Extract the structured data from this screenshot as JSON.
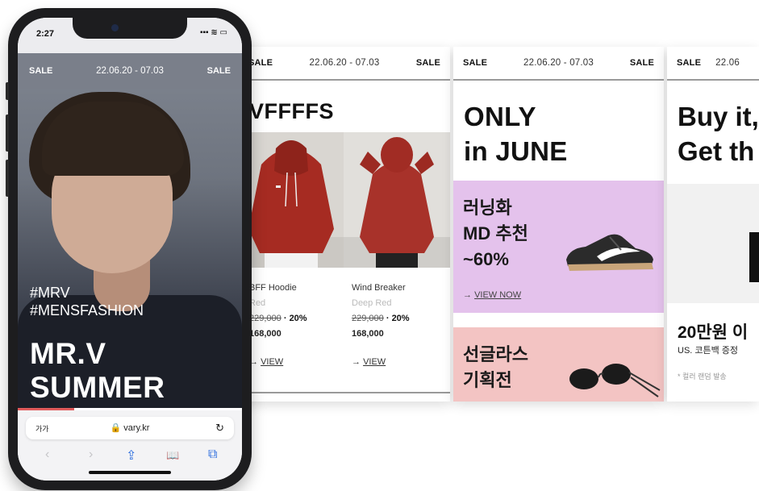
{
  "phone": {
    "status": {
      "time": "2:27",
      "signal_icons": "▪▪▪ ≋ ▭"
    },
    "header": {
      "left": "SALE",
      "date": "22.06.20 - 07.03",
      "right": "SALE"
    },
    "hashtags": [
      "#MRV",
      "#MENSFASHION"
    ],
    "title_lines": [
      "MR.V",
      "SUMMER"
    ],
    "progress": 0.25,
    "browser": {
      "aa_label": "가가",
      "url": "🔒 vary.kr",
      "reload_icon": "↻",
      "back_icon": "‹",
      "forward_icon": "›",
      "share_icon": "⇪",
      "bookmarks_icon": "📖",
      "tabs_icon": "⧉"
    }
  },
  "panel2": {
    "header": {
      "left": "SALE",
      "date": "22.06.20 - 07.03",
      "right": "SALE"
    },
    "title": "VFFFFS",
    "products": [
      {
        "name": "BFF Hoodie",
        "color": "Red",
        "old_price": "229,000",
        "discount": "20%",
        "price": "168,000",
        "link": "VIEW"
      },
      {
        "name": "Wind Breaker",
        "color": "Deep Red",
        "old_price": "229,000",
        "discount": "20%",
        "price": "168,000",
        "link": "VIEW"
      }
    ],
    "arrow": "→",
    "dot": "·"
  },
  "panel3": {
    "header": {
      "left": "SALE",
      "date": "22.06.20 - 07.03",
      "right": "SALE"
    },
    "title_lines": [
      "ONLY",
      "in JUNE"
    ],
    "promo1": {
      "lines": [
        "러닝화",
        "MD 추천",
        "~60%"
      ],
      "link": "VIEW NOW",
      "arrow": "→"
    },
    "promo2": {
      "lines": [
        "선글라스",
        "기획전"
      ]
    }
  },
  "panel4": {
    "header": {
      "left": "SALE",
      "date": "22.06"
    },
    "title_lines": [
      "Buy it,",
      "Get th"
    ],
    "amount": "20만원 이",
    "gift": "US. 코튼백 증정",
    "note": "* 컬러 랜덤 발송"
  },
  "colors": {
    "promo_purple": "#e4c2ec",
    "promo_pink": "#f3c4c3",
    "progress": "#e05a5a",
    "ios_blue": "#2f6fdf"
  }
}
